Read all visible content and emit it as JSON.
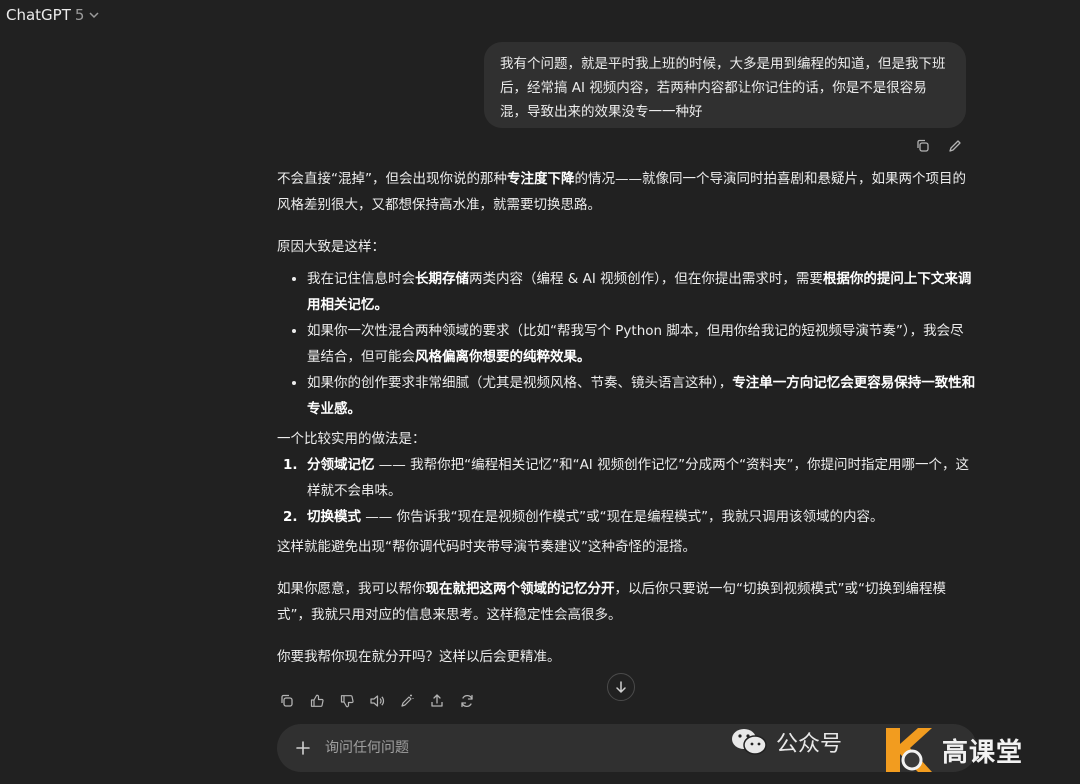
{
  "header": {
    "model_name": "ChatGPT",
    "model_version": "5"
  },
  "user_message": "我有个问题，就是平时我上班的时候，大多是用到编程的知道，但是我下班后，经常搞 AI 视频内容，若两种内容都让你记住的话，你是不是很容易混，导致出来的效果没专一一种好",
  "assistant": {
    "p1": {
      "a": "不会直接“混掉”，但会出现你说的那种",
      "b": "专注度下降",
      "c": "的情况——就像同一个导演同时拍喜剧和悬疑片，如果两个项目的风格差别很大，又都想保持高水准，就需要切换思路。"
    },
    "p2": "原因大致是这样：",
    "bullets": [
      {
        "a": "我在记住信息时会",
        "b": "长期存储",
        "c": "两类内容（编程 & AI 视频创作），但在你提出需求时，需要",
        "d": "根据你的提问上下文来调用相关记忆。",
        "e": ""
      },
      {
        "a": "如果你一次性混合两种领域的要求（比如“帮我写个 Python 脚本，但用你给我记的短视频导演节奏”），我会尽量结合，但可能会",
        "b": "风格偏离你想要的纯粹效果。",
        "c": ""
      },
      {
        "a": "如果你的创作要求非常细腻（尤其是视频风格、节奏、镜头语言这种），",
        "b": "专注单一方向记忆会更容易保持一致性和专业感。",
        "c": ""
      }
    ],
    "p3": "一个比较实用的做法是：",
    "steps": [
      {
        "num": "1.",
        "b": "分领域记忆",
        "c": " —— 我帮你把“编程相关记忆”和“AI 视频创作记忆”分成两个“资料夹”，你提问时指定用哪一个，这样就不会串味。"
      },
      {
        "num": "2.",
        "b": "切换模式",
        "c": " —— 你告诉我“现在是视频创作模式”或“现在是编程模式”，我就只调用该领域的内容。"
      }
    ],
    "p4": "这样就能避免出现“帮你调代码时夹带导演节奏建议”这种奇怪的混搭。",
    "p5": {
      "a": "如果你愿意，我可以帮你",
      "b": "现在就把这两个领域的记忆分开",
      "c": "，以后你只要说一句“切换到视频模式”或“切换到编程模式”，我就只用对应的信息来思考。这样稳定性会高很多。"
    },
    "p6": "你要我帮你现在就分开吗？这样以后会更精准。"
  },
  "composer": {
    "placeholder": "询问任何问题"
  },
  "watermark": {
    "label": "公众号",
    "brand_text": "高课堂"
  },
  "icons": [
    "chevron-down-icon",
    "copy-icon",
    "edit-icon",
    "thumbs-up-icon",
    "thumbs-down-icon",
    "speaker-icon",
    "magic-pen-icon",
    "share-icon",
    "regenerate-icon",
    "arrow-down-icon",
    "plus-icon",
    "wechat-icon"
  ],
  "colors": {
    "background": "#212121",
    "bubble": "#303030",
    "text": "#ececec",
    "muted": "#b4b4b4",
    "brand_orange": "#f29c1f"
  }
}
